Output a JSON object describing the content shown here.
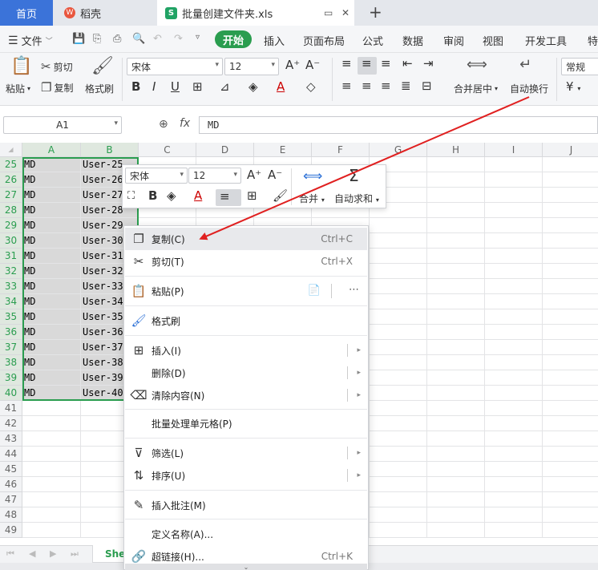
{
  "tabs": {
    "home": "首页",
    "doc": "稻壳",
    "doc_badge": "W",
    "file": "批量创建文件夹.xls",
    "file_icon": "S"
  },
  "menu": {
    "file": "文件",
    "items": [
      "开始",
      "插入",
      "页面布局",
      "公式",
      "数据",
      "审阅",
      "视图",
      "开发工具",
      "特"
    ]
  },
  "ribbon": {
    "paste": "粘贴",
    "cut": "剪切",
    "copy": "复制",
    "format_painter": "格式刷",
    "font_name": "宋体",
    "font_size": "12",
    "merge_center": "合并居中",
    "wrap_text": "自动换行",
    "number_format": "常规",
    "currency_symbol": "¥"
  },
  "formula_bar": {
    "name_box": "A1",
    "fx": "fx",
    "formula": "MD"
  },
  "columns": [
    "A",
    "B",
    "C",
    "D",
    "E",
    "F",
    "G",
    "H",
    "I",
    "J"
  ],
  "rows": [
    {
      "num": "25",
      "a": "MD",
      "b": "User-25"
    },
    {
      "num": "26",
      "a": "MD",
      "b": "User-26"
    },
    {
      "num": "27",
      "a": "MD",
      "b": "User-27"
    },
    {
      "num": "28",
      "a": "MD",
      "b": "User-28"
    },
    {
      "num": "29",
      "a": "MD",
      "b": "User-29"
    },
    {
      "num": "30",
      "a": "MD",
      "b": "User-30"
    },
    {
      "num": "31",
      "a": "MD",
      "b": "User-31"
    },
    {
      "num": "32",
      "a": "MD",
      "b": "User-32"
    },
    {
      "num": "33",
      "a": "MD",
      "b": "User-33"
    },
    {
      "num": "34",
      "a": "MD",
      "b": "User-34"
    },
    {
      "num": "35",
      "a": "MD",
      "b": "User-35"
    },
    {
      "num": "36",
      "a": "MD",
      "b": "User-36"
    },
    {
      "num": "37",
      "a": "MD",
      "b": "User-37"
    },
    {
      "num": "38",
      "a": "MD",
      "b": "User-38"
    },
    {
      "num": "39",
      "a": "MD",
      "b": "User-39"
    },
    {
      "num": "40",
      "a": "MD",
      "b": "User-40"
    },
    {
      "num": "41",
      "a": "",
      "b": ""
    },
    {
      "num": "42",
      "a": "",
      "b": ""
    },
    {
      "num": "43",
      "a": "",
      "b": ""
    },
    {
      "num": "44",
      "a": "",
      "b": ""
    },
    {
      "num": "45",
      "a": "",
      "b": ""
    },
    {
      "num": "46",
      "a": "",
      "b": ""
    },
    {
      "num": "47",
      "a": "",
      "b": ""
    },
    {
      "num": "48",
      "a": "",
      "b": ""
    },
    {
      "num": "49",
      "a": "",
      "b": ""
    }
  ],
  "sheet_tab": "She",
  "mini_toolbar": {
    "font_name": "宋体",
    "font_size": "12",
    "merge": "合并",
    "autosum": "自动求和"
  },
  "context_menu": [
    {
      "label": "复制(C)",
      "shortcut": "Ctrl+C",
      "icon": "copy-icon",
      "glyph": "❐"
    },
    {
      "label": "剪切(T)",
      "shortcut": "Ctrl+X",
      "icon": "scissors-icon",
      "glyph": "✂"
    },
    {
      "label": "粘贴(P)",
      "shortcut": "",
      "icon": "paste-icon",
      "glyph": "📋"
    },
    {
      "label": "格式刷",
      "shortcut": "",
      "icon": "format-painter-icon",
      "glyph": "🖌"
    },
    {
      "label": "插入(I)",
      "shortcut": "",
      "icon": "insert-icon",
      "glyph": "⊞"
    },
    {
      "label": "删除(D)",
      "shortcut": "",
      "icon": "",
      "glyph": ""
    },
    {
      "label": "清除内容(N)",
      "shortcut": "",
      "icon": "eraser-icon",
      "glyph": "⌫"
    },
    {
      "label": "批量处理单元格(P)",
      "shortcut": "",
      "icon": "",
      "glyph": ""
    },
    {
      "label": "筛选(L)",
      "shortcut": "",
      "icon": "filter-icon",
      "glyph": "⊽"
    },
    {
      "label": "排序(U)",
      "shortcut": "",
      "icon": "sort-icon",
      "glyph": "⇅"
    },
    {
      "label": "插入批注(M)",
      "shortcut": "",
      "icon": "comment-icon",
      "glyph": "✎"
    },
    {
      "label": "定义名称(A)...",
      "shortcut": "",
      "icon": "",
      "glyph": ""
    },
    {
      "label": "超链接(H)...",
      "shortcut": "Ctrl+K",
      "icon": "link-icon",
      "glyph": "🔗"
    }
  ],
  "colors": {
    "accent_green": "#2a9d4f",
    "home_tab_blue": "#3b73d9",
    "annotation_red": "#e02020"
  }
}
